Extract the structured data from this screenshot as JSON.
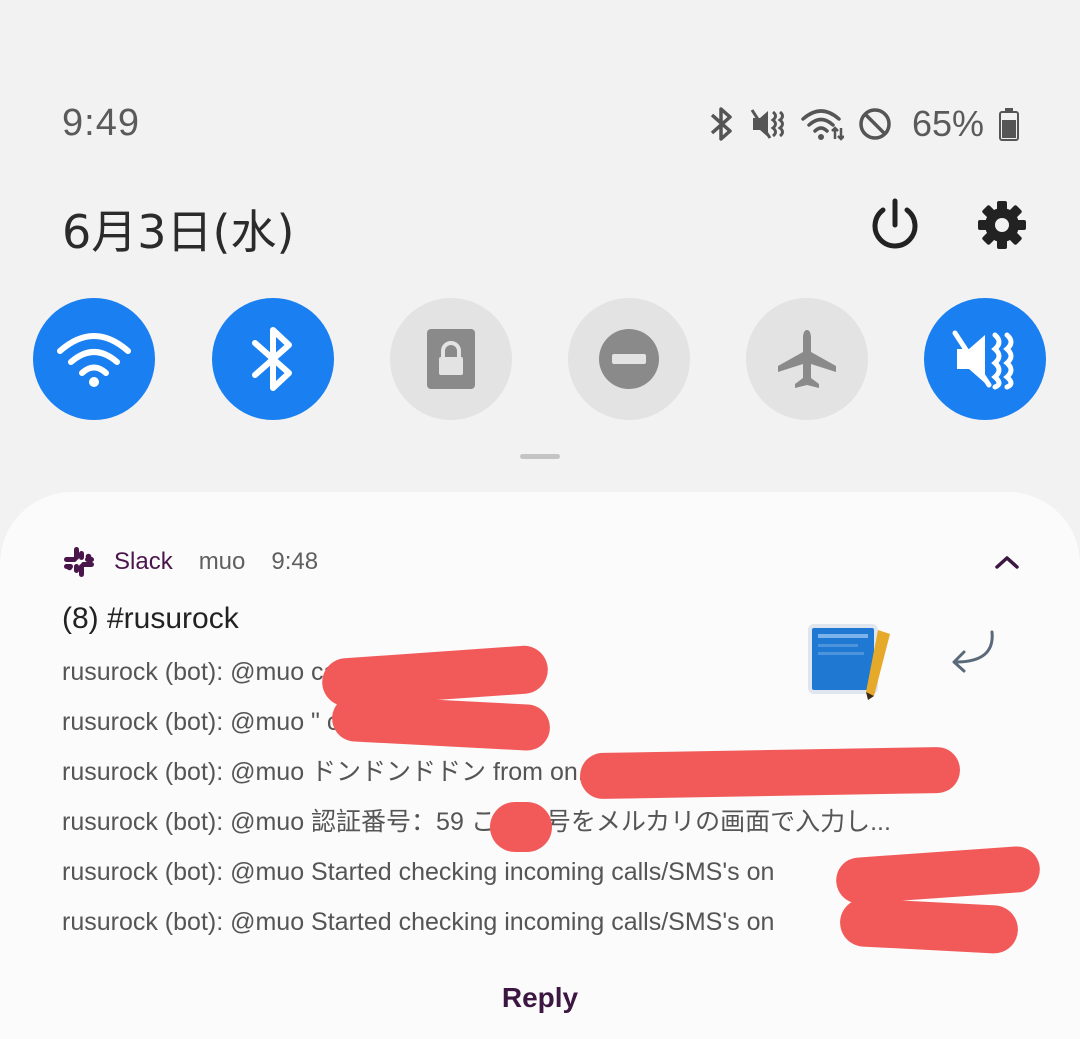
{
  "status_bar": {
    "time": "9:49",
    "battery": "65%",
    "icons": [
      "bluetooth-icon",
      "vibrate-mute-icon",
      "wifi-icon",
      "do-not-disturb-icon",
      "battery-icon"
    ]
  },
  "date_row": {
    "date": "6月3日(水)",
    "icons": [
      "power-icon",
      "settings-icon"
    ]
  },
  "quick_tiles": [
    {
      "name": "wifi",
      "state": "on",
      "icon": "wifi-icon"
    },
    {
      "name": "bluetooth",
      "state": "on",
      "icon": "bluetooth-icon"
    },
    {
      "name": "screen-lock",
      "state": "off",
      "icon": "lock-icon"
    },
    {
      "name": "do-not-disturb",
      "state": "off",
      "icon": "do-not-disturb-icon"
    },
    {
      "name": "airplane",
      "state": "off",
      "icon": "airplane-icon"
    },
    {
      "name": "sound",
      "state": "on",
      "icon": "vibrate-mute-icon"
    }
  ],
  "notification": {
    "app": "Slack",
    "account": "muo",
    "time": "9:48",
    "title": "(8) #rusurock",
    "messages": [
      "rusurock (bot): @muo                                  calling",
      "rusurock (bot): @muo \"                                calling",
      "rusurock (bot): @muo ドンドンドドン from                                        on...",
      "rusurock (bot): @muo 認証番号：59          この番号をメルカリの画面で入力し...",
      "rusurock (bot): @muo Started checking incoming calls/SMS's on",
      "rusurock (bot): @muo Started checking incoming calls/SMS's on"
    ],
    "reply_label": "Reply"
  },
  "colors": {
    "accent": "#1a7ff0",
    "tile_off": "#e3e3e3",
    "slack_purple": "#4a154b",
    "redaction": "#f25a5a"
  }
}
